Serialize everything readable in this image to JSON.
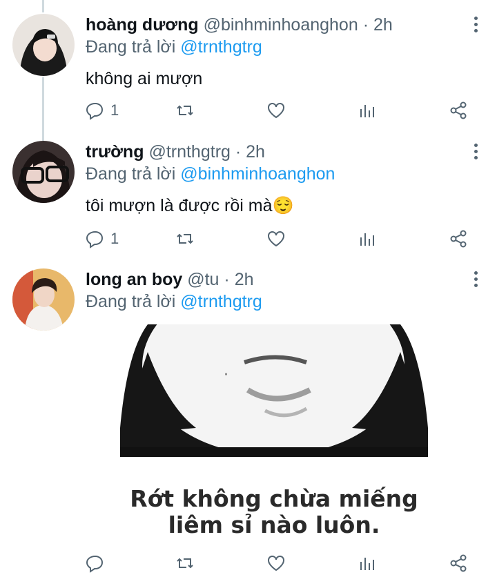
{
  "colors": {
    "accent": "#1d9bf0",
    "secondary": "#536471",
    "line": "#cfd9de"
  },
  "tweets": [
    {
      "name": "hoàng dương",
      "handle": "@binhminhoanghon",
      "dot": "·",
      "time": "2h",
      "reply_prefix": "Đang trả lời",
      "reply_to": "@trnthgtrg",
      "text": "không ai mượn",
      "reply_count": "1"
    },
    {
      "name": "trường",
      "handle": "@trnthgtrg",
      "dot": "·",
      "time": "2h",
      "reply_prefix": "Đang trả lời",
      "reply_to": "@binhminhoanghon",
      "text": "tôi mượn là được rồi mà😌",
      "reply_count": "1"
    },
    {
      "name": "long an boy",
      "handle": "@tu",
      "dot": "·",
      "time": "2h",
      "reply_prefix": "Đang trả lời",
      "reply_to": "@trnthgtrg",
      "media_caption_line1": "Rớt không chừa miếng",
      "media_caption_line2": "liêm sỉ nào luôn.",
      "reply_count": ""
    }
  ],
  "icons": [
    "reply-icon",
    "retweet-icon",
    "like-icon",
    "analytics-icon",
    "share-icon",
    "more-icon"
  ]
}
